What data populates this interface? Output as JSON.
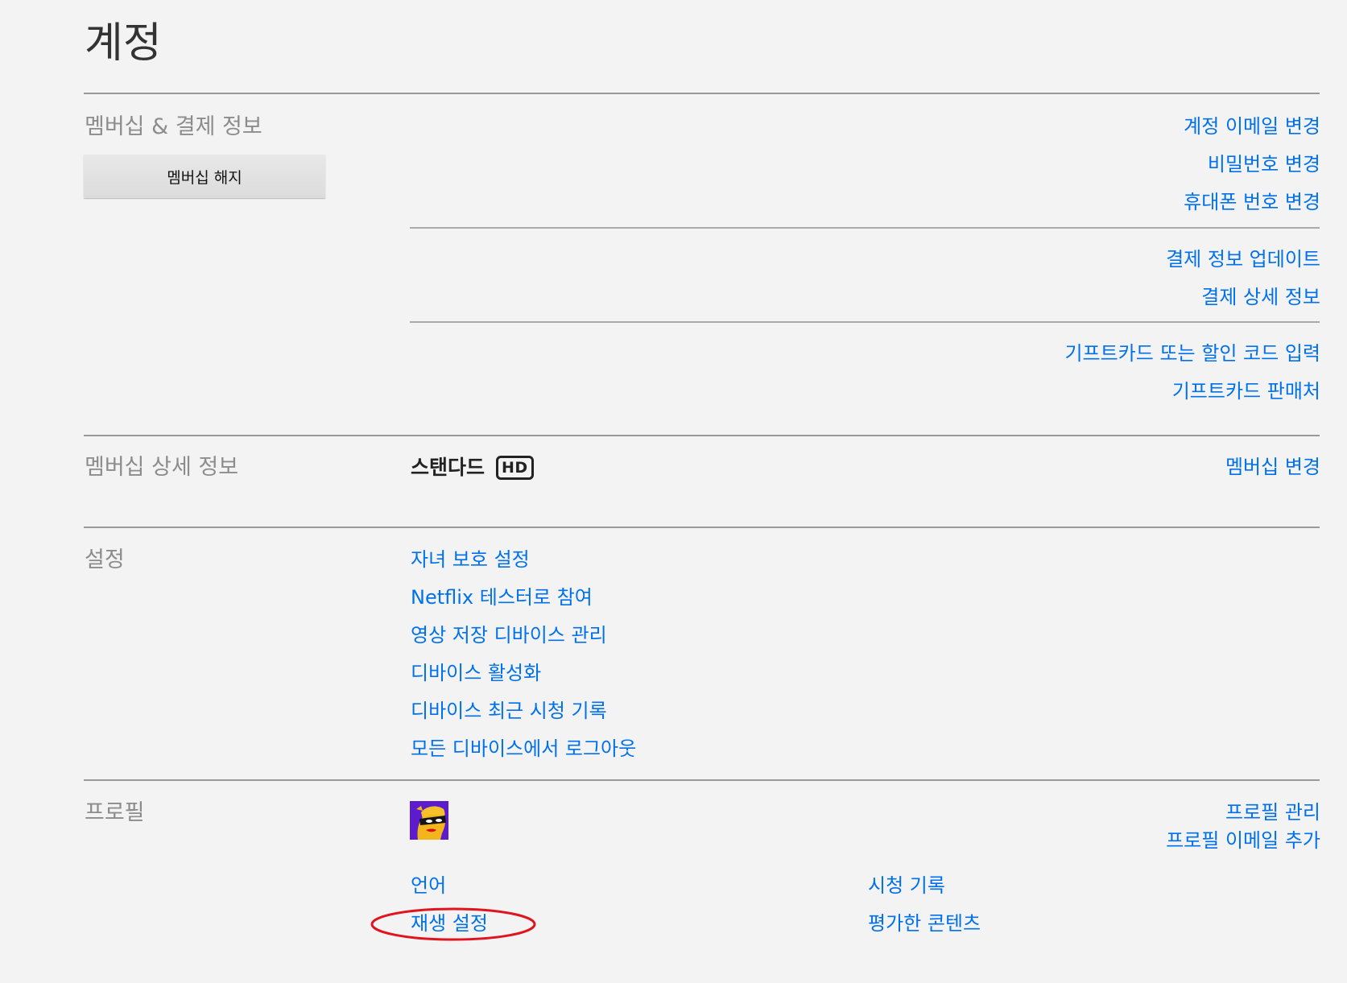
{
  "page": {
    "title": "계정"
  },
  "membership_billing": {
    "label": "멤버십 & 결제 정보",
    "cancel_button": "멤버십 해지",
    "account_links": [
      "계정 이메일 변경",
      "비밀번호 변경",
      "휴대폰 번호 변경"
    ],
    "billing_links": [
      "결제 정보 업데이트",
      "결제 상세 정보"
    ],
    "gift_links": [
      "기프트카드 또는 할인 코드 입력",
      "기프트카드 판매처"
    ]
  },
  "plan_details": {
    "label": "멤버십 상세 정보",
    "plan_name": "스탠다드",
    "badge": "HD",
    "change_link": "멤버십 변경"
  },
  "settings": {
    "label": "설정",
    "links": [
      "자녀 보호 설정",
      "Netflix 테스터로 참여",
      "영상 저장 디바이스 관리",
      "디바이스 활성화",
      "디바이스 최근 시청 기록",
      "모든 디바이스에서 로그아웃"
    ]
  },
  "profile": {
    "label": "프로필",
    "manage_link": "프로필 관리",
    "add_email_link": "프로필 이메일 추가",
    "left_links": [
      "언어",
      "재생 설정"
    ],
    "right_links": [
      "시청 기록",
      "평가한 콘텐츠"
    ]
  },
  "colors": {
    "link": "#0071eb",
    "background": "#f3f3f3",
    "annotation": "#e0141e"
  }
}
